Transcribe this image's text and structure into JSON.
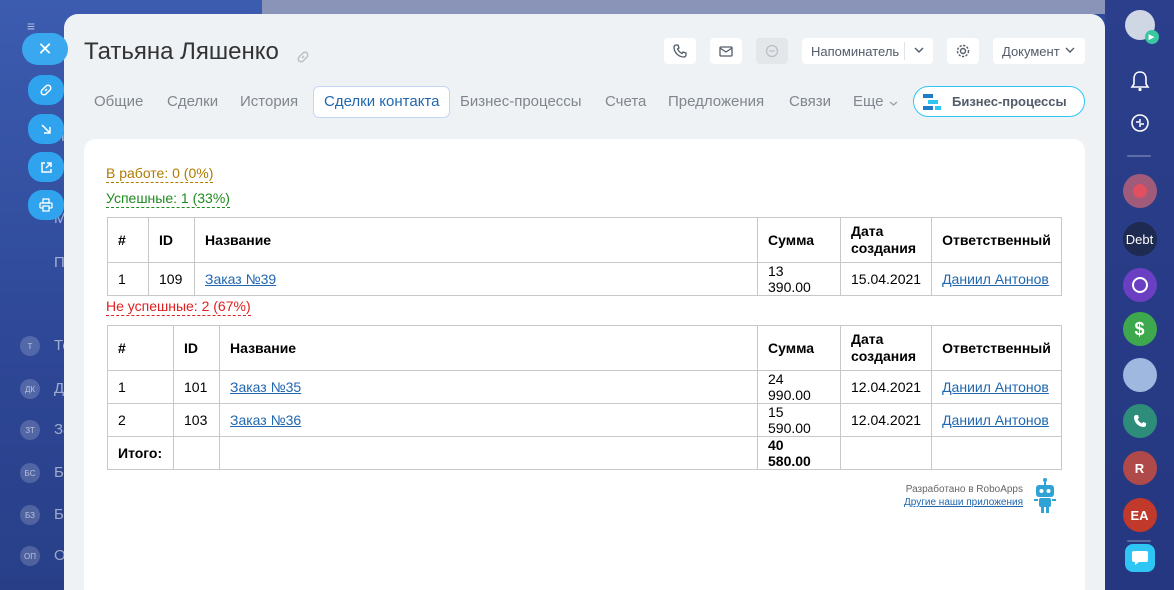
{
  "background": {
    "left_letters": [
      "Т",
      "ДК",
      "ЗТ",
      "БС",
      "БЗ",
      "ОП"
    ],
    "left_texts": [
      "Те",
      "Д",
      "За",
      "Б",
      "Б",
      "О"
    ],
    "top_menu_letters": [
      "П",
      "М",
      "П"
    ]
  },
  "title": "Татьяна Ляшенко",
  "header": {
    "reminder_label": "Напоминатель",
    "document_label": "Документ"
  },
  "tabs": [
    {
      "label": "Общие"
    },
    {
      "label": "Сделки"
    },
    {
      "label": "История"
    },
    {
      "label": "Сделки контакта"
    },
    {
      "label": "Бизнес-процессы"
    },
    {
      "label": "Счета"
    },
    {
      "label": "Предложения"
    },
    {
      "label": "Связи"
    },
    {
      "label": "Еще"
    }
  ],
  "bp_button_label": "Бизнес-процессы",
  "stats": {
    "in_work": "В работе: 0 (0%)",
    "success": "Успешные: 1 (33%)",
    "fail": "Не успешные: 2 (67%)"
  },
  "colors": {
    "in_work": "#b07b00",
    "success": "#1f8a1f",
    "fail": "#e02020",
    "accent": "#2fc6f6"
  },
  "table_headers": {
    "num": "#",
    "id": "ID",
    "name": "Название",
    "sum": "Сумма",
    "date": "Дата создания",
    "responsible": "Ответственный"
  },
  "success_rows": [
    {
      "num": "1",
      "id": "109",
      "name": "Заказ №39",
      "sum": "13 390.00",
      "date": "15.04.2021",
      "responsible": "Даниил Антонов"
    }
  ],
  "fail_rows": [
    {
      "num": "1",
      "id": "101",
      "name": "Заказ №35",
      "sum": "24 990.00",
      "date": "12.04.2021",
      "responsible": "Даниил Антонов"
    },
    {
      "num": "2",
      "id": "103",
      "name": "Заказ №36",
      "sum": "15 590.00",
      "date": "12.04.2021",
      "responsible": "Даниил Антонов"
    }
  ],
  "fail_total": {
    "label": "Итого:",
    "sum": "40 580.00"
  },
  "footer": {
    "developed_by": "Разработано в RoboApps",
    "other_apps": "Другие наши приложения"
  },
  "right_bar": {
    "debt_label": "Debt",
    "r_label": "R",
    "ea_label": "EA"
  }
}
